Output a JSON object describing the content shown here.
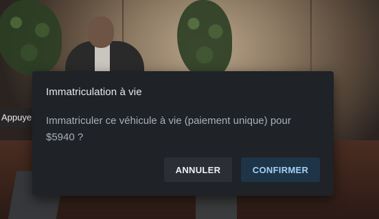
{
  "background": {
    "sign_text": "Appuyer s"
  },
  "dialog": {
    "title": "Immatriculation à vie",
    "message": "Immatriculer ce véhicule à vie (paiement unique) pour $5940 ?",
    "cancel_label": "ANNULER",
    "confirm_label": "CONFIRMER"
  },
  "colors": {
    "dialog_bg": "#1f2227",
    "confirm_text": "#a3d2f7",
    "confirm_bg": "#1e3447",
    "cancel_bg": "#2b2f35"
  }
}
